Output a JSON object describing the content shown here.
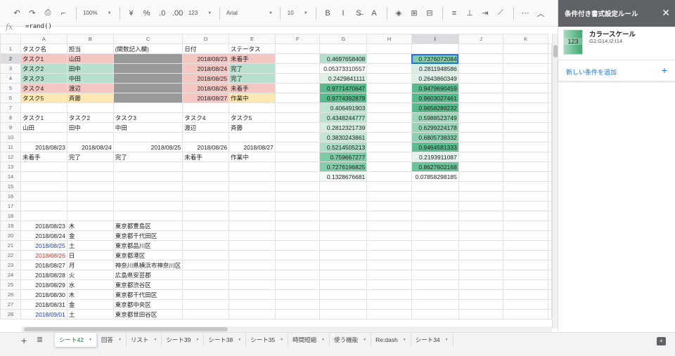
{
  "toolbar": {
    "items": [
      {
        "name": "undo-icon",
        "glyph": "↶"
      },
      {
        "name": "redo-icon",
        "glyph": "↷"
      },
      {
        "name": "print-icon",
        "glyph": "⎙"
      },
      {
        "name": "paint-format-icon",
        "glyph": "⌐"
      },
      {
        "sep": true
      },
      {
        "name": "zoom-dropdown",
        "label": "100%",
        "dd": true
      },
      {
        "sep": true
      },
      {
        "name": "currency-button",
        "glyph": "¥"
      },
      {
        "name": "percent-button",
        "glyph": "%"
      },
      {
        "name": "decrease-decimal-button",
        "glyph": ".0"
      },
      {
        "name": "increase-decimal-button",
        "glyph": ".00"
      },
      {
        "name": "number-format-dropdown",
        "label": "123",
        "dd": true
      },
      {
        "sep": true
      },
      {
        "name": "font-dropdown",
        "label": "Arial",
        "dd": true,
        "wide": true
      },
      {
        "sep": true
      },
      {
        "name": "font-size-dropdown",
        "label": "10",
        "dd": true
      },
      {
        "sep": true
      },
      {
        "name": "bold-button",
        "glyph": "B"
      },
      {
        "name": "italic-button",
        "glyph": "I"
      },
      {
        "name": "strikethrough-button",
        "glyph": "S̶"
      },
      {
        "name": "text-color-button",
        "glyph": "A"
      },
      {
        "sep": true
      },
      {
        "name": "fill-color-icon",
        "glyph": "◈"
      },
      {
        "name": "borders-icon",
        "glyph": "⊞"
      },
      {
        "name": "merge-cells-icon",
        "glyph": "⊟"
      },
      {
        "sep": true
      },
      {
        "name": "align-horizontal-icon",
        "glyph": "≡"
      },
      {
        "name": "align-vertical-icon",
        "glyph": "⊥"
      },
      {
        "name": "text-wrap-icon",
        "glyph": "⇥"
      },
      {
        "name": "text-rotate-icon",
        "glyph": "⟋"
      },
      {
        "sep": true
      },
      {
        "name": "more-icon",
        "glyph": "⋯"
      }
    ],
    "collapse_glyph": "︿"
  },
  "formula_bar": {
    "fx": "fx",
    "formula": "=rand()"
  },
  "grid": {
    "columns": [
      "A",
      "B",
      "C",
      "D",
      "E",
      "F",
      "G",
      "H",
      "I",
      "J",
      "K"
    ],
    "selected_column": "I",
    "selected_row": 2,
    "rows": [
      [
        "タスク名",
        "担当",
        "(関数記入欄)",
        "日付",
        "ステータス",
        "",
        "",
        "",
        "",
        "",
        ""
      ],
      [
        "タスク1",
        "山田",
        "",
        "2018/08/23",
        "未着手",
        "",
        "0.4697658408",
        "",
        "0.7376072084",
        "",
        ""
      ],
      [
        "タスク2",
        "田中",
        "",
        "2018/08/24",
        "完了",
        "",
        "0.05373310557",
        "",
        "0.2811948586",
        "",
        ""
      ],
      [
        "タスク3",
        "中田",
        "",
        "2018/08/25",
        "完了",
        "",
        "0.2429841111",
        "",
        "0.2643860349",
        "",
        ""
      ],
      [
        "タスク4",
        "渡辺",
        "",
        "2018/08/26",
        "未着手",
        "",
        "0.9771470647",
        "",
        "0.9479690459",
        "",
        ""
      ],
      [
        "タスク5",
        "斉藤",
        "",
        "2018/08/27",
        "作業中",
        "",
        "0.9774392879",
        "",
        "0.9603027461",
        "",
        ""
      ],
      [
        "",
        "",
        "",
        "",
        "",
        "",
        "0.406491903",
        "",
        "0.9658289232",
        "",
        ""
      ],
      [
        "タスク1",
        "タスク2",
        "タスク3",
        "タスク4",
        "タスク5",
        "",
        "0.4348244777",
        "",
        "0.5988523749",
        "",
        ""
      ],
      [
        "山田",
        "田中",
        "中田",
        "渡辺",
        "斉藤",
        "",
        "0.2812321739",
        "",
        "0.6299224178",
        "",
        ""
      ],
      [
        "",
        "",
        "",
        "",
        "",
        "",
        "0.3830243861",
        "",
        "0.6805738332",
        "",
        ""
      ],
      [
        "2018/08/23",
        "2018/08/24",
        "2018/08/25",
        "2018/08/26",
        "2018/08/27",
        "",
        "0.5214505213",
        "",
        "0.9464581333",
        "",
        ""
      ],
      [
        "未着手",
        "完了",
        "完了",
        "未着手",
        "作業中",
        "",
        "0.759667277",
        "",
        "0.2193911087",
        "",
        ""
      ],
      [
        "",
        "",
        "",
        "",
        "",
        "",
        "0.7276196825",
        "",
        "0.8627602168",
        "",
        ""
      ],
      [
        "",
        "",
        "",
        "",
        "",
        "",
        "0.1328676681",
        "",
        "0.07858298185",
        "",
        ""
      ],
      [
        "",
        "",
        "",
        "",
        "",
        "",
        "",
        "",
        "",
        "",
        ""
      ],
      [
        "",
        "",
        "",
        "",
        "",
        "",
        "",
        "",
        "",
        "",
        ""
      ],
      [
        "",
        "",
        "",
        "",
        "",
        "",
        "",
        "",
        "",
        "",
        ""
      ],
      [
        "",
        "",
        "",
        "",
        "",
        "",
        "",
        "",
        "",
        "",
        ""
      ],
      [
        "2018/08/23",
        "木",
        "東京都豊島区",
        "",
        "",
        "",
        "",
        "",
        "",
        "",
        ""
      ],
      [
        "2018/08/24",
        "金",
        "東京都千代田区",
        "",
        "",
        "",
        "",
        "",
        "",
        "",
        ""
      ],
      [
        "2018/08/25",
        "土",
        "東京都品川区",
        "",
        "",
        "",
        "",
        "",
        "",
        "",
        ""
      ],
      [
        "2018/08/26",
        "日",
        "東京都港区",
        "",
        "",
        "",
        "",
        "",
        "",
        "",
        ""
      ],
      [
        "2018/08/27",
        "月",
        "神奈川県横浜市神奈川区",
        "",
        "",
        "",
        "",
        "",
        "",
        "",
        ""
      ],
      [
        "2018/08/28",
        "火",
        "広島県安芸郡",
        "",
        "",
        "",
        "",
        "",
        "",
        "",
        ""
      ],
      [
        "2018/08/29",
        "水",
        "東京都渋谷区",
        "",
        "",
        "",
        "",
        "",
        "",
        "",
        ""
      ],
      [
        "2018/08/30",
        "木",
        "東京都千代田区",
        "",
        "",
        "",
        "",
        "",
        "",
        "",
        ""
      ],
      [
        "2018/08/31",
        "金",
        "東京都中央区",
        "",
        "",
        "",
        "",
        "",
        "",
        "",
        ""
      ],
      [
        "2018/09/01",
        "土",
        "東京都世田谷区",
        "",
        "",
        "",
        "",
        "",
        "",
        "",
        ""
      ]
    ],
    "colors": {
      "red": "#f4c7c3",
      "green": "#b7e1cd",
      "yellow": "#fce8b2",
      "gray": "#999999",
      "saturday": "#1f3fbf",
      "sunday": "#d93025",
      "scale_low": "#ffffff",
      "scale_high": "#57bb8a"
    }
  },
  "side_panel": {
    "title": "条件付き書式設定ルール",
    "close_glyph": "✕",
    "rule": {
      "swatch_label": "123",
      "title": "カラースケール",
      "range": "G2:G14,I2:I14"
    },
    "add_rule_label": "新しい条件を追加",
    "add_glyph": "+"
  },
  "sheet_tabs": {
    "add_glyph": "+",
    "list_glyph": "≣",
    "active": 0,
    "tabs": [
      "シート42",
      "回答",
      "リスト",
      "シート39",
      "シート38",
      "シート35",
      "時間短縮",
      "使う機能",
      "Re:dash",
      "シート34"
    ],
    "explore_glyph": "+"
  }
}
